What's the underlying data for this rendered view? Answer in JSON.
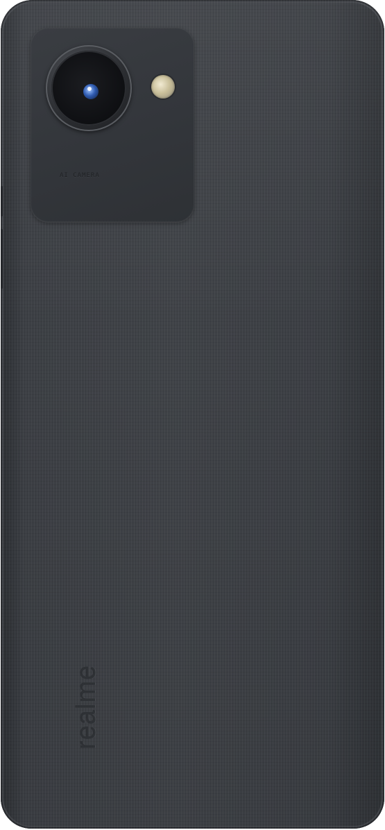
{
  "photo": {
    "subject": "smartphone-back",
    "camera_module_label": "AI CAMERA",
    "brand_logo": "realme"
  },
  "colors": {
    "body": "#3d4045",
    "camera_module": "#33363b",
    "lens_accent": "#2f5bb0",
    "flash": "#d8cfae",
    "background": "#ffffff"
  }
}
